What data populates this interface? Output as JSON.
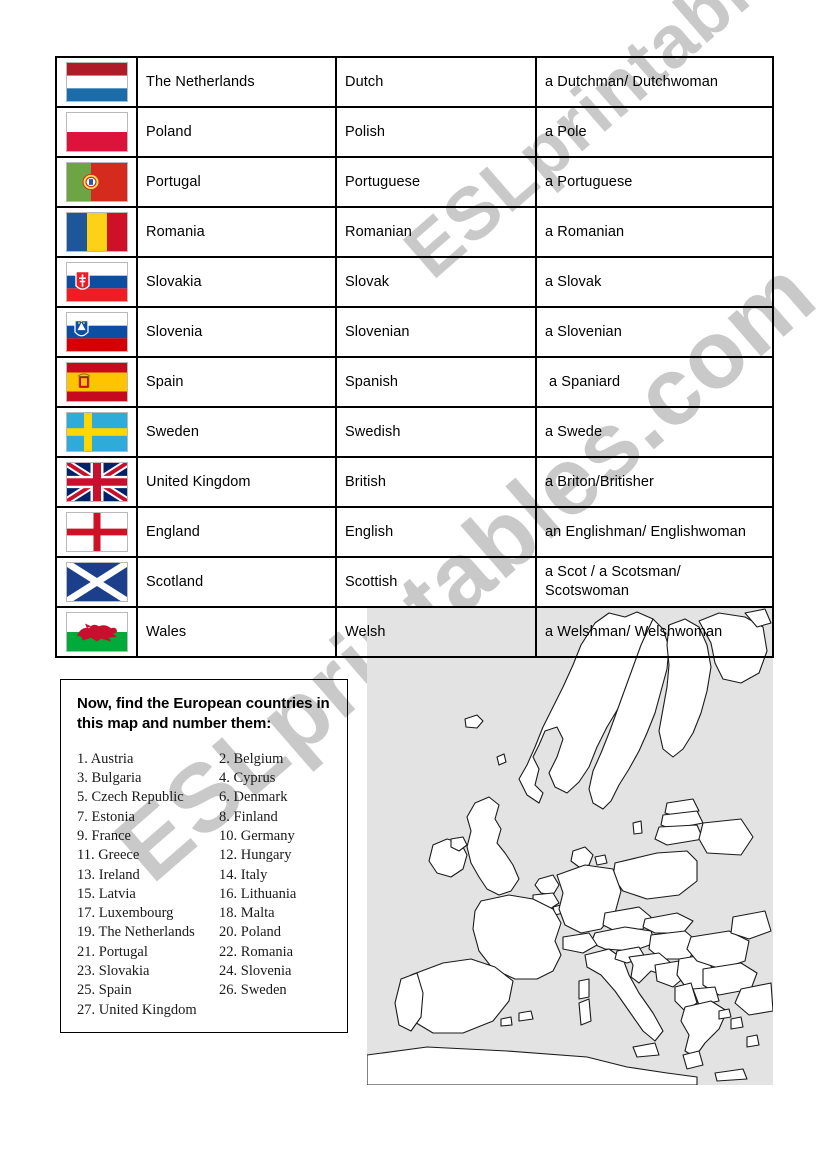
{
  "watermark": {
    "line1": "ESLprintables.com",
    "line2": "ESLprintables.com",
    "color": "#c9c9c9"
  },
  "table": {
    "columns": [
      "flag",
      "country",
      "nationality_adjective",
      "person_noun"
    ],
    "rows": [
      {
        "flag": "netherlands-flag",
        "country": "The Netherlands",
        "adjective": "Dutch",
        "person": "a Dutchman/ Dutchwoman"
      },
      {
        "flag": "poland-flag",
        "country": "Poland",
        "adjective": "Polish",
        "person": "a Pole"
      },
      {
        "flag": "portugal-flag",
        "country": "Portugal",
        "adjective": "Portuguese",
        "person": "a Portuguese"
      },
      {
        "flag": "romania-flag",
        "country": "Romania",
        "adjective": "Romanian",
        "person": "a Romanian"
      },
      {
        "flag": "slovakia-flag",
        "country": "Slovakia",
        "adjective": "Slovak",
        "person": "a Slovak"
      },
      {
        "flag": "slovenia-flag",
        "country": "Slovenia",
        "adjective": "Slovenian",
        "person": "a Slovenian"
      },
      {
        "flag": "spain-flag",
        "country": "Spain",
        "adjective": "Spanish",
        "person": "a Spaniard"
      },
      {
        "flag": "sweden-flag",
        "country": "Sweden",
        "adjective": "Swedish",
        "person": "a Swede"
      },
      {
        "flag": "united-kingdom-flag",
        "country": "United Kingdom",
        "adjective": "British",
        "person": "a Briton/Britisher"
      },
      {
        "flag": "england-flag",
        "country": "England",
        "adjective": "English",
        "person": "an Englishman/ Englishwoman"
      },
      {
        "flag": "scotland-flag",
        "country": "Scotland",
        "adjective": "Scottish",
        "person": "a Scot / a Scotsman/ Scotswoman"
      },
      {
        "flag": "wales-flag",
        "country": "Wales",
        "adjective": "Welsh",
        "person": "a Welshman/ Welshwoman"
      }
    ]
  },
  "exercise": {
    "heading": "Now, find the European countries in this map and number them:",
    "items": [
      "1. Austria",
      "2. Belgium",
      "3. Bulgaria",
      "4. Cyprus",
      "5. Czech Republic",
      "6. Denmark",
      "7. Estonia",
      "8. Finland",
      "9. France",
      "10. Germany",
      "11. Greece",
      "12. Hungary",
      "13. Ireland",
      "14. Italy",
      "15. Latvia",
      "16. Lithuania",
      "17. Luxembourg",
      "18. Malta",
      "19. The Netherlands",
      "20. Poland",
      "21. Portugal",
      "22. Romania",
      "23. Slovakia",
      "24. Slovenia",
      "25. Spain",
      "26. Sweden",
      "27. United Kingdom"
    ]
  },
  "map": {
    "name": "blank-outline-map-of-europe",
    "sea_color": "#e3e3e3",
    "land_color": "#ffffff",
    "border_color": "#1a1a1a"
  }
}
